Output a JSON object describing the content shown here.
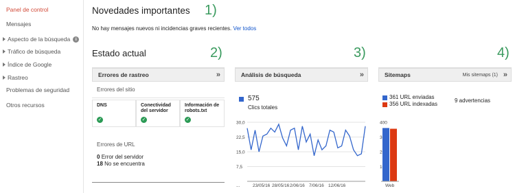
{
  "sidebar": {
    "items": [
      {
        "label": "Panel de control",
        "caret": false
      },
      {
        "label": "Mensajes",
        "caret": false
      },
      {
        "label": "Aspecto de la búsqueda",
        "caret": true,
        "info": "i"
      },
      {
        "label": "Tráfico de búsqueda",
        "caret": true
      },
      {
        "label": "Índice de Google",
        "caret": true
      },
      {
        "label": "Rastreo",
        "caret": true
      },
      {
        "label": "Problemas de seguridad",
        "caret": false
      },
      {
        "label": "Otros recursos",
        "caret": false
      }
    ]
  },
  "main": {
    "title": "Novedades importantes",
    "message": "No hay mensajes nuevos ni incidencias graves recientes.",
    "message_link": "Ver todos",
    "section_title": "Estado actual",
    "annotations": [
      "1)",
      "2)",
      "3)",
      "4)"
    ]
  },
  "crawl_errors": {
    "title": "Errores de rastreo",
    "chevron": "»",
    "site_errors_label": "Errores del sitio",
    "boxes": [
      {
        "label_lines": [
          "DNS"
        ],
        "status_icon": "check-icon"
      },
      {
        "label_lines": [
          "Conectividad",
          "del servidor"
        ],
        "status_icon": "check-icon"
      },
      {
        "label_lines": [
          "Información de",
          "robots.txt"
        ],
        "status_icon": "check-icon"
      }
    ],
    "url_errors_label": "Errores de URL",
    "url_errors": [
      {
        "count": "0",
        "label": "Error del servidor"
      },
      {
        "count": "18",
        "label": "No se encuentra"
      }
    ]
  },
  "search_analytics": {
    "title": "Análisis de búsqueda",
    "chevron": "»",
    "total": "575",
    "total_label": "Clics totales",
    "color": "#3366cc"
  },
  "sitemaps": {
    "title": "Sitemaps",
    "link": "Mis sitemaps (1)",
    "chevron": "»",
    "submitted": "361 URL enviadas",
    "indexed": "356 URL indexadas",
    "warnings": "9 advertencias",
    "submitted_color": "#3366cc",
    "indexed_color": "#dc3912"
  },
  "chart_data": [
    {
      "type": "line",
      "title": "",
      "ylim": [
        0,
        30
      ],
      "y_ticks": [
        "30,0",
        "22,5",
        "15,0",
        "7,5"
      ],
      "x_tick_labels": [
        "...",
        "23/05/16",
        "28/05/16",
        "2/06/16",
        "7/06/16",
        "12/06/16"
      ],
      "series": [
        {
          "values": [
            27,
            16,
            26,
            15,
            23,
            24,
            27,
            25,
            29,
            22,
            18,
            26,
            27,
            16,
            28,
            20,
            24,
            13,
            21,
            16,
            18,
            26,
            25,
            17,
            18,
            26,
            23,
            16,
            13,
            14,
            28
          ]
        }
      ]
    },
    {
      "type": "bar",
      "title": "",
      "categories": [
        "Web"
      ],
      "ylim": [
        0,
        400
      ],
      "y_ticks": [
        "400",
        "300",
        "200",
        "100"
      ],
      "series": [
        {
          "name": "URL enviadas",
          "values": [
            361
          ]
        },
        {
          "name": "URL indexadas",
          "values": [
            356
          ]
        }
      ]
    }
  ]
}
